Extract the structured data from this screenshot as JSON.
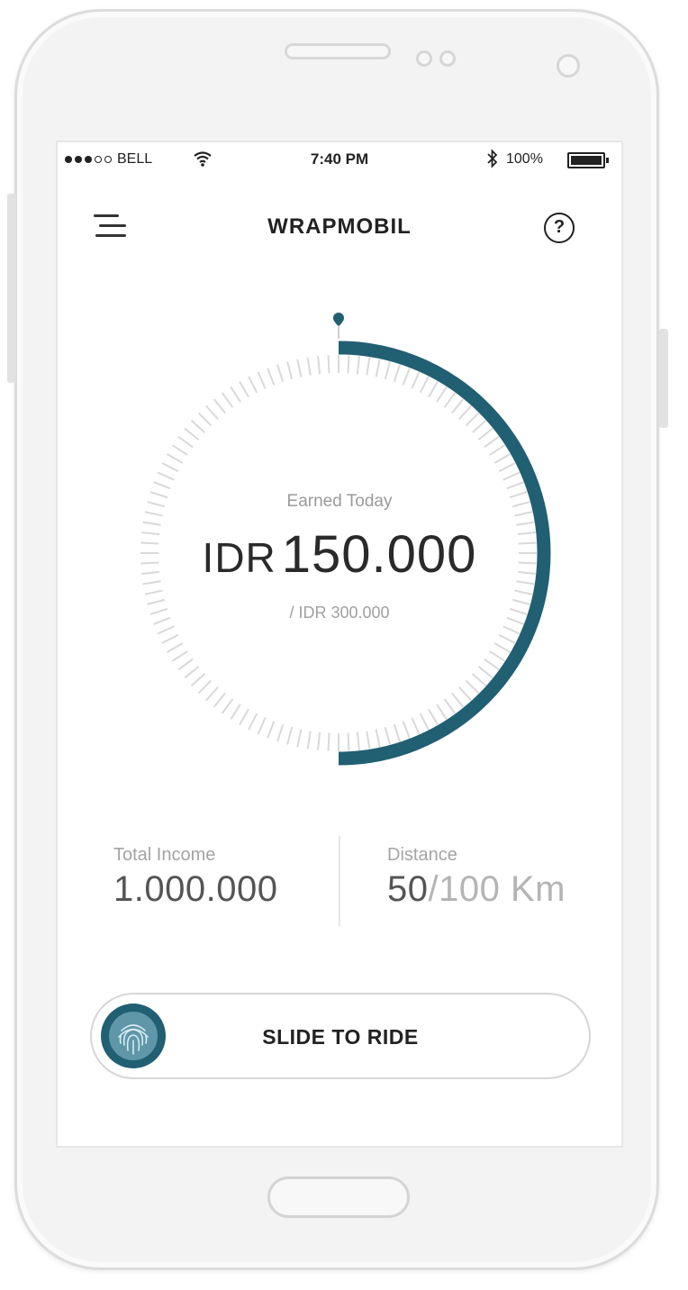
{
  "status_bar": {
    "carrier": "BELL",
    "time": "7:40 PM",
    "battery": "100%",
    "signal_bars_filled": 3,
    "signal_bars_total": 5
  },
  "header": {
    "title": "WRAPMOBIL",
    "menu_icon": "hamburger-menu-icon",
    "help_icon": "question-circle-icon",
    "help_glyph": "?"
  },
  "earnings": {
    "label": "Earned Today",
    "currency": "IDR",
    "amount": "150.000",
    "target": "/ IDR 300.000",
    "progress": 0.5
  },
  "stats": {
    "total_income_label": "Total Income",
    "total_income_value": "1.000.000",
    "distance_label": "Distance",
    "distance_current": "50",
    "distance_total": "/100 Km"
  },
  "slider": {
    "label": "SLIDE TO RIDE",
    "thumb_icon": "fingerprint-icon"
  },
  "colors": {
    "accent": "#215f73",
    "track": "#d9d9d9"
  }
}
